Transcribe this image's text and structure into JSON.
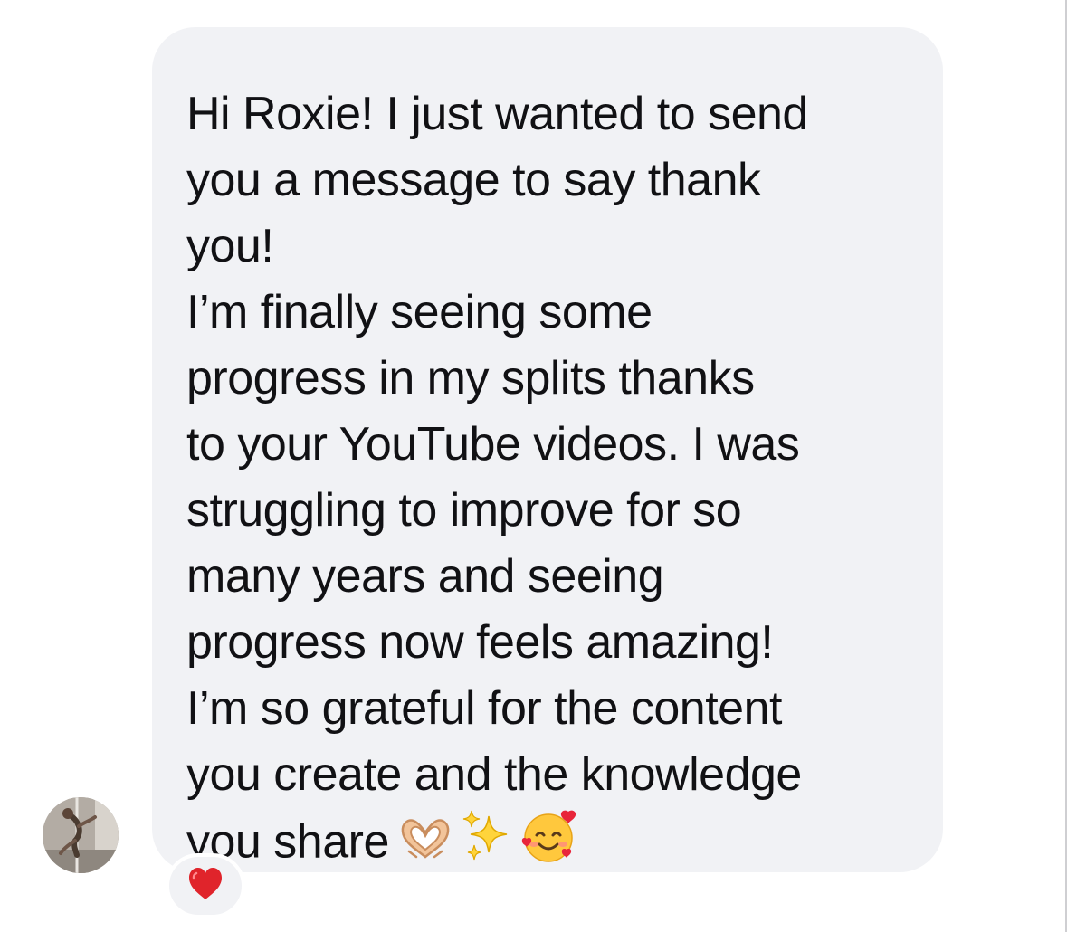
{
  "message": {
    "lines": [
      "Hi Roxie! I just wanted to send",
      "you a message to say thank",
      "you!",
      "I’m finally seeing some",
      "progress in my splits thanks",
      "to your YouTube videos. I was",
      "struggling to improve for so",
      "many years and seeing",
      "progress now feels amazing!",
      "I’m so grateful for the content",
      "you create and the knowledge",
      "you share"
    ],
    "emojis": [
      "heart-hands-icon",
      "sparkles-icon",
      "smiling-face-with-hearts-icon"
    ]
  },
  "reaction": {
    "icon": "red-heart-icon",
    "color": "#e0242b"
  },
  "sender": {
    "avatar_icon": "avatar"
  },
  "colors": {
    "bubble": "#f1f2f5",
    "text": "#111114",
    "background": "#ffffff"
  }
}
